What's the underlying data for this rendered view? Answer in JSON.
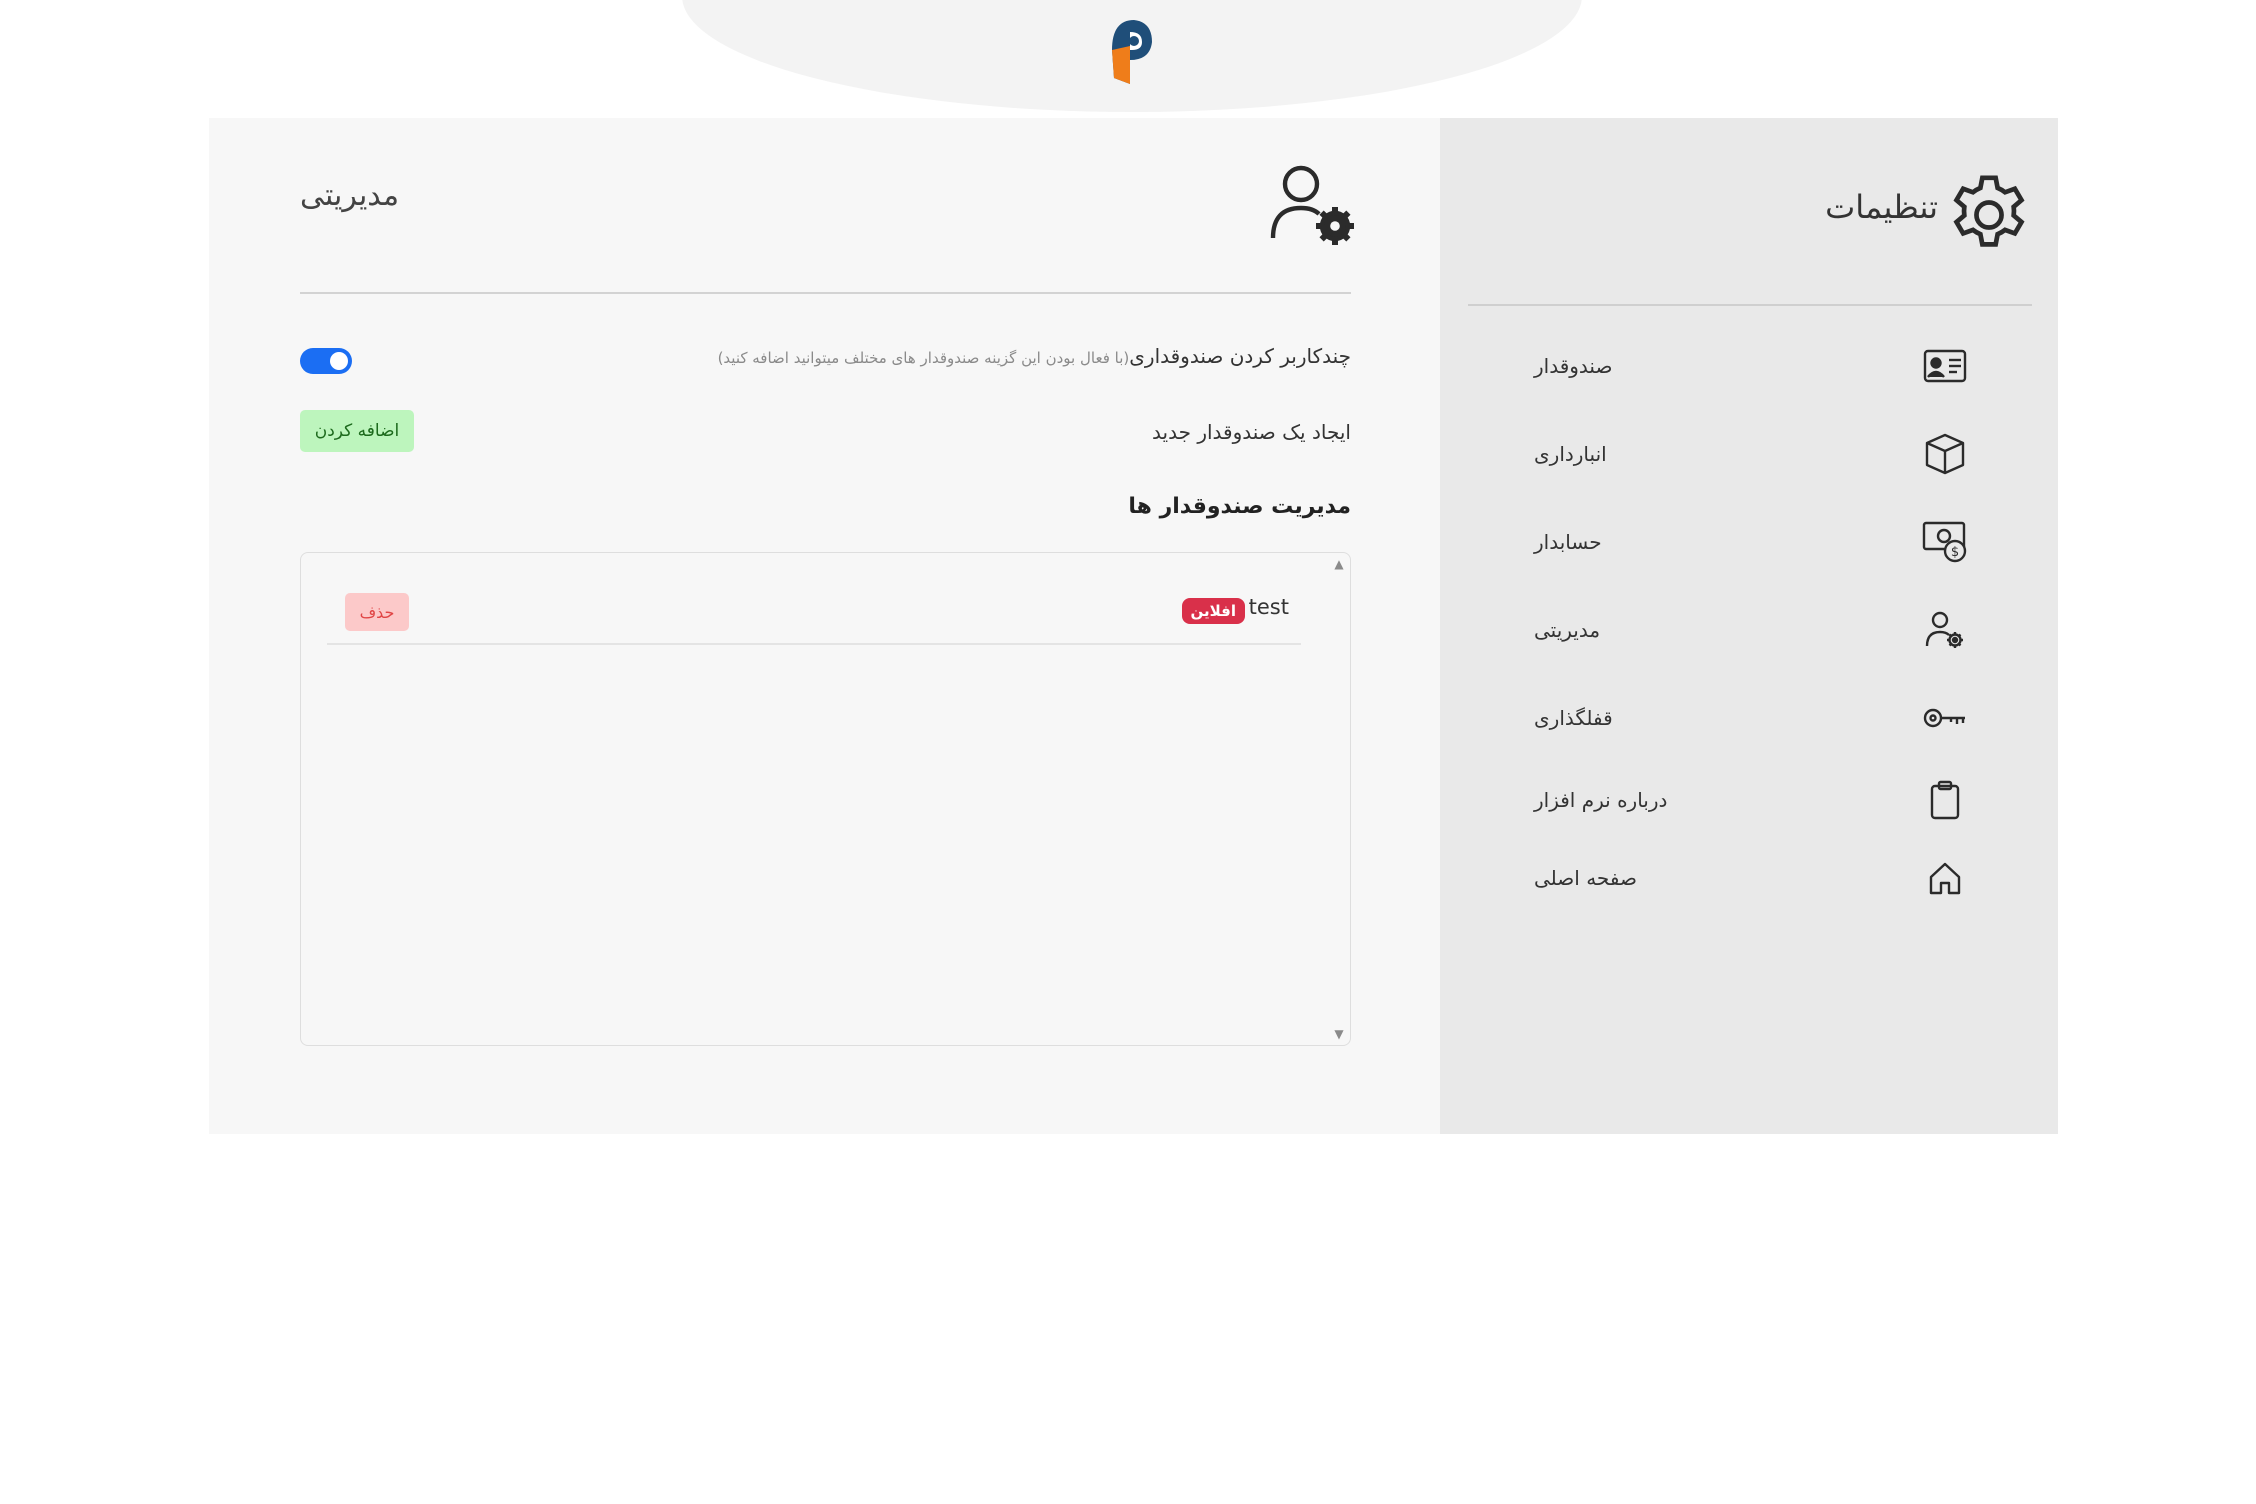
{
  "settings": {
    "title": "تنظیمات",
    "menu": [
      {
        "label": "صندوقدار",
        "icon": "id-card-icon"
      },
      {
        "label": "انبارداری",
        "icon": "box-icon"
      },
      {
        "label": "حسابدار",
        "icon": "money-icon"
      },
      {
        "label": "مدیریتی",
        "icon": "user-gear-icon"
      },
      {
        "label": "قفلگذاری",
        "icon": "key-icon"
      },
      {
        "label": "درباره نرم افزار",
        "icon": "clipboard-icon"
      },
      {
        "label": "صفحه اصلی",
        "icon": "home-icon"
      }
    ]
  },
  "main": {
    "title": "مدیریتی",
    "icon": "user-gear-icon",
    "multi_user": {
      "label": "چندکاربر کردن صندوقداری",
      "hint": "(با فعال بودن این گزینه صندوقدار های مختلف میتوانید اضافه کنید)",
      "enabled": true
    },
    "new_cashier": {
      "label": "ایجاد یک صندوقدار جدید",
      "button": "اضافه کردن"
    },
    "manage_title": "مدیریت صندوقدار ها",
    "cashiers": [
      {
        "name": "test",
        "status": "افلاین",
        "delete_label": "حذف"
      }
    ]
  },
  "colors": {
    "toggle_on": "#1b6ef3",
    "add_button_bg": "#bdf5bd",
    "offline_badge": "#d9304a",
    "delete_bg": "#fcc9c9"
  }
}
